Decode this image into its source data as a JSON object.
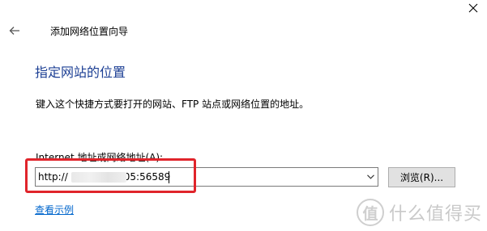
{
  "window": {
    "title": "添加网络位置向导"
  },
  "page": {
    "heading": "指定网站的位置",
    "instruction": "键入这个快捷方式要打开的网站、FTP 站点或网络位置的地址。",
    "address_label": "Internet 地址或网络地址(A):",
    "address_value": "http://",
    "address_value_suffix": "05:56589",
    "browse_label": "浏览(R)...",
    "examples_link": "查看示例"
  },
  "watermark": {
    "logo": "值",
    "text": "什么值得买"
  },
  "colors": {
    "heading": "#1c3f94",
    "link": "#0066cc",
    "highlight": "#e0242b"
  },
  "icons": {
    "back": "back-arrow-icon",
    "close": "close-icon",
    "dropdown": "chevron-down-icon"
  }
}
